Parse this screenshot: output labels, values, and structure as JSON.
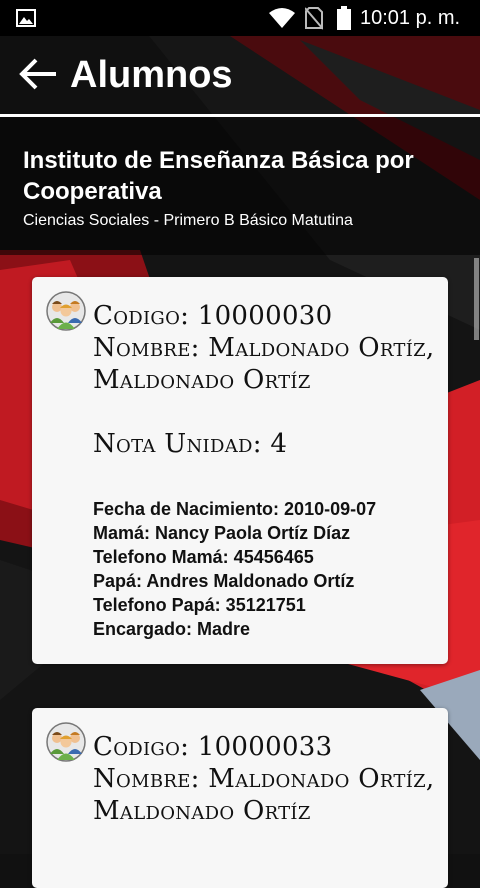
{
  "status_bar": {
    "time": "10:01 p. m."
  },
  "app_bar": {
    "title": "Alumnos"
  },
  "header": {
    "school": "Instituto de Enseñanza Básica por Cooperativa",
    "course": "Ciencias Sociales - Primero B Básico Matutina"
  },
  "students": [
    {
      "codigo": "Codigo: 10000030",
      "nombre": "Nombre: Maldonado Ortíz,",
      "nombre_cont": "Maldonado Ortíz",
      "nota": "Nota Unidad: 4",
      "fecha": "Fecha de Nacimiento: 2010-09-07",
      "mama": "Mamá: Nancy Paola Ortíz Díaz",
      "tel_mama": "Telefono Mamá: 45456465",
      "papa": "Papá: Andres Maldonado Ortíz",
      "tel_papa": "Telefono Papá: 35121751",
      "encargado": "Encargado: Madre"
    },
    {
      "codigo": "Codigo: 10000033",
      "nombre": "Nombre: Maldonado Ortíz,",
      "nombre_cont": "Maldonado Ortíz"
    }
  ],
  "colors": {
    "background": "#111111",
    "card": "#f7f7f7",
    "accent_red": "#c8102e"
  },
  "icons": {
    "status_left": "image-icon",
    "back": "arrow-back-icon",
    "avatar": "students-group-icon"
  }
}
